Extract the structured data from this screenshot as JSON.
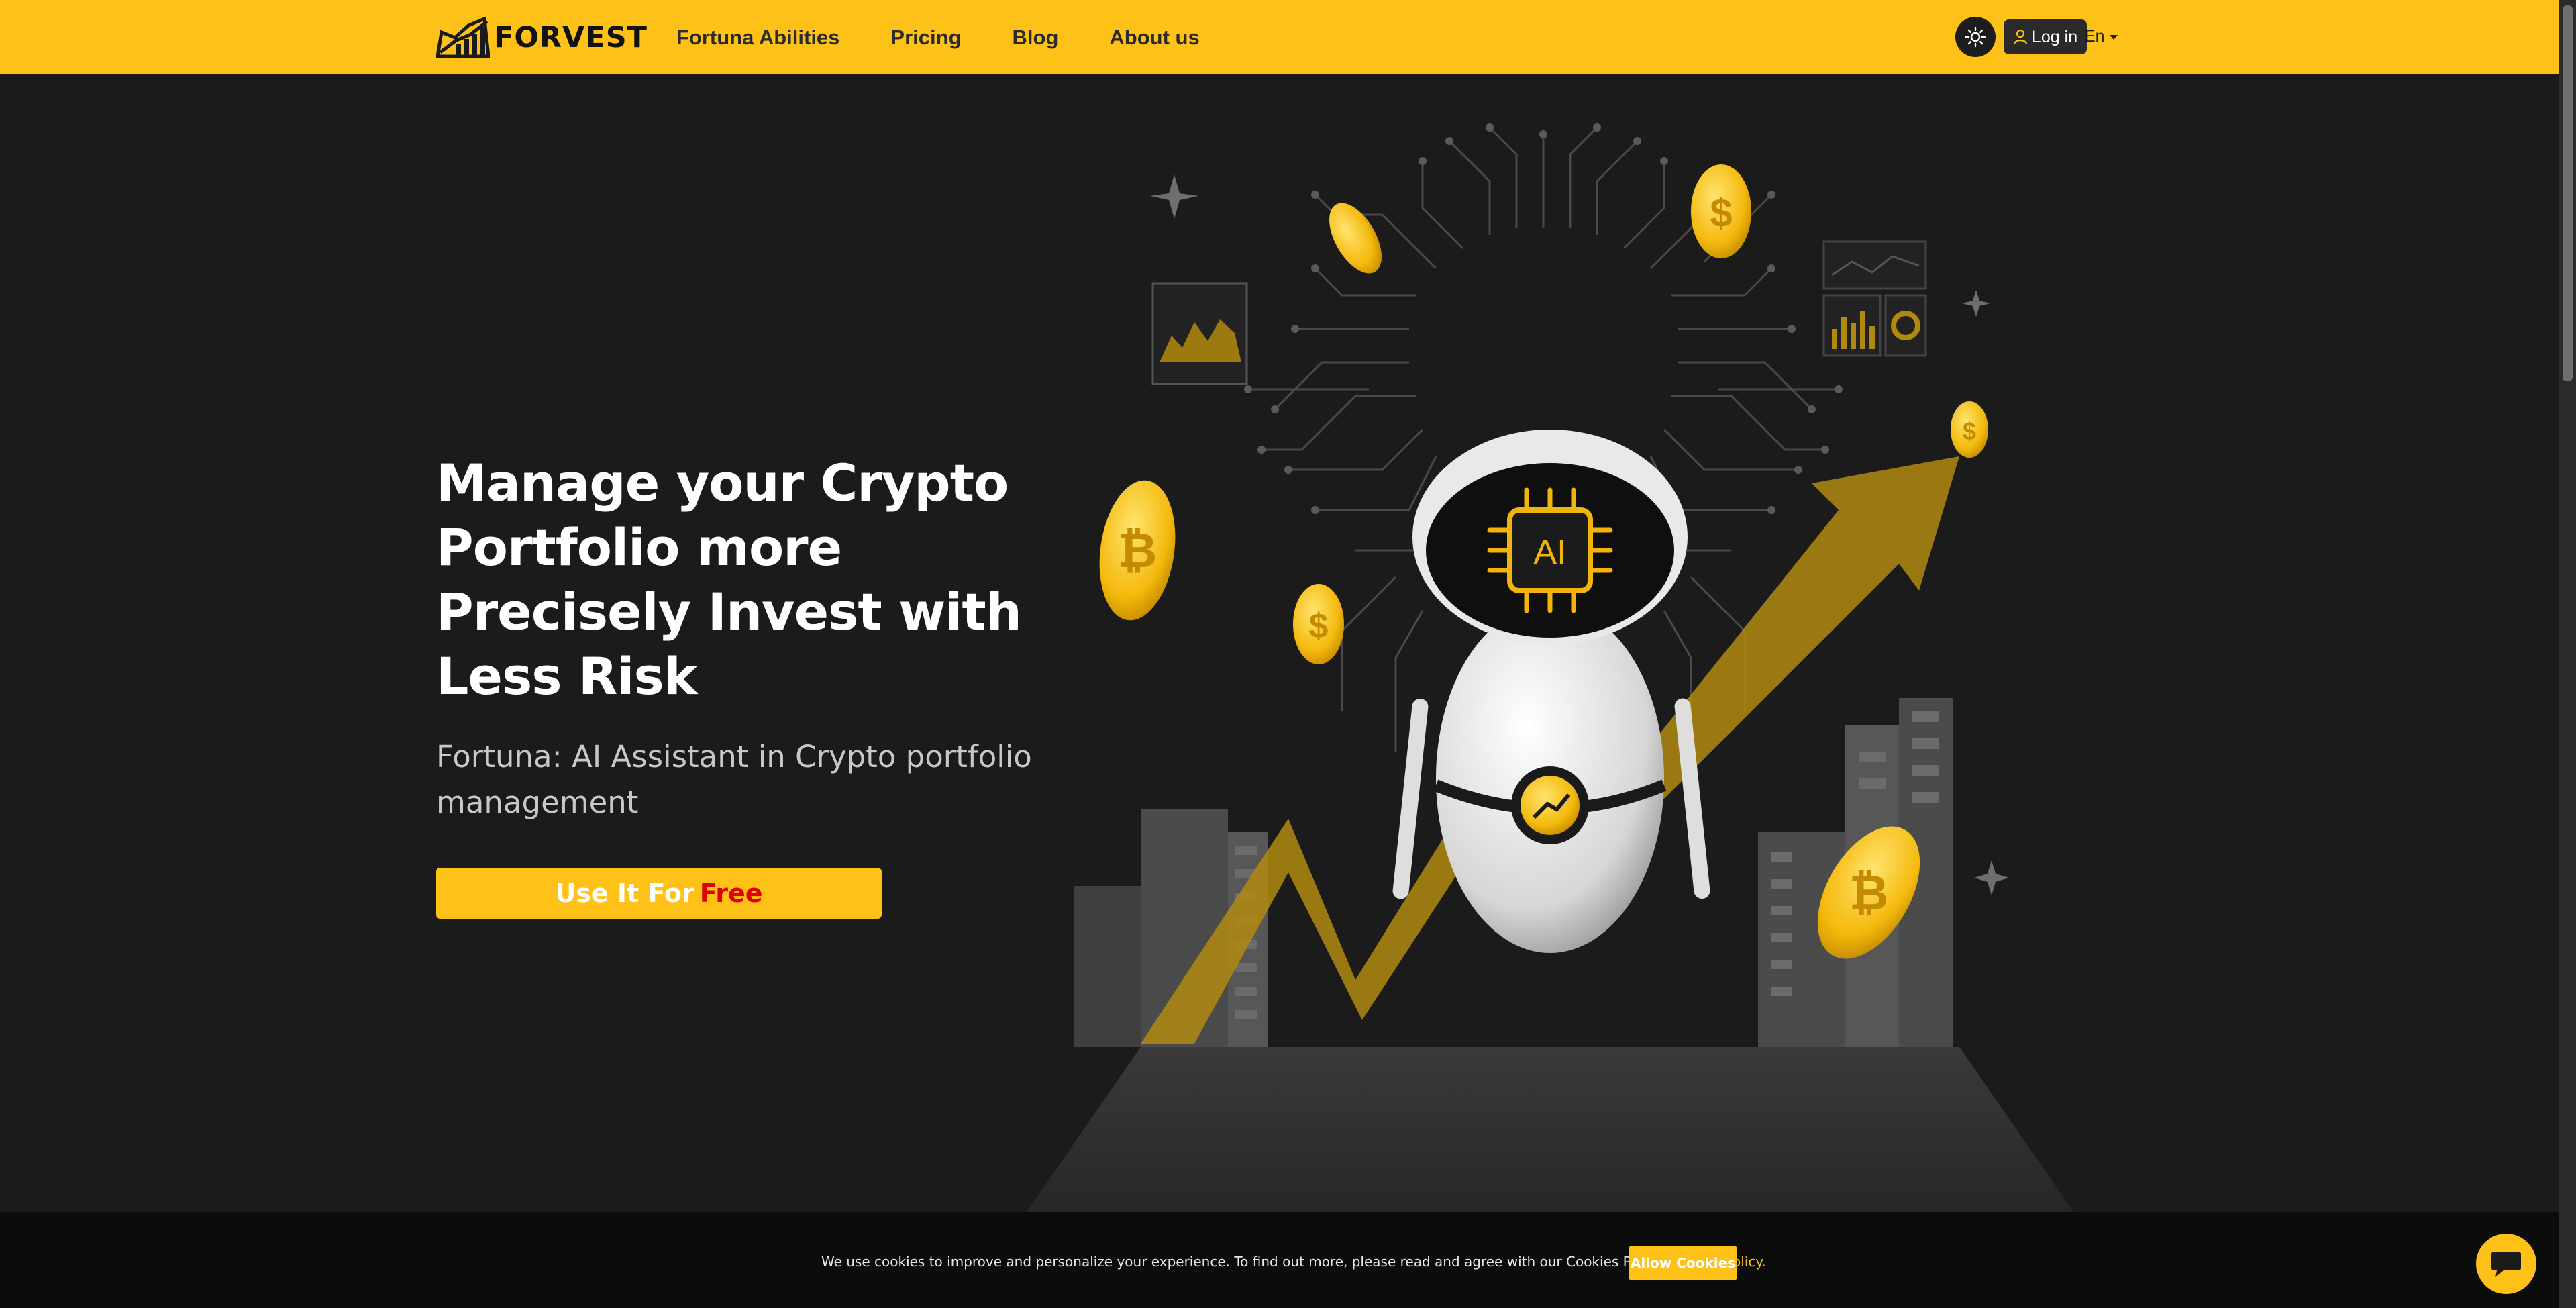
{
  "header": {
    "logo_text": "FORVEST",
    "nav": [
      {
        "label": "Fortuna Abilities"
      },
      {
        "label": "Pricing"
      },
      {
        "label": "Blog"
      },
      {
        "label": "About us"
      }
    ],
    "login_label": "Log in",
    "language": "En"
  },
  "hero": {
    "title": "Manage your Crypto Portfolio more Precisely Invest with Less Risk",
    "subtitle": "Fortuna: AI Assistant in Crypto portfolio management",
    "cta_prefix": "Use It For",
    "cta_highlight": "Free",
    "robot_label": "AI"
  },
  "cookie": {
    "text": "We use cookies to improve and personalize your experience. To find out more, please read and agree with our Cookies Policy.",
    "link_label": "Cookies Policy.",
    "allow_label": "Allow Cookies"
  },
  "colors": {
    "brand_yellow": "#fec117",
    "background": "#1b1b1b",
    "cta_free": "#e00000"
  },
  "icons": {
    "theme": "sun-icon",
    "login": "user-icon",
    "language": "caret-down-icon",
    "chat": "chat-icon"
  }
}
